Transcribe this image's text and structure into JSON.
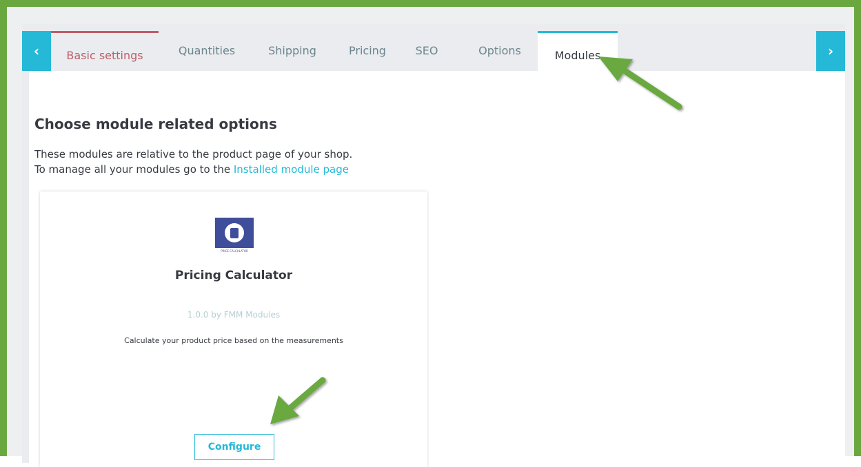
{
  "nav": {
    "prev_icon": "‹",
    "next_icon": "›"
  },
  "tabs": [
    {
      "label": "Basic settings"
    },
    {
      "label": "Quantities"
    },
    {
      "label": "Shipping"
    },
    {
      "label": "Pricing"
    },
    {
      "label": "SEO"
    },
    {
      "label": "Options"
    },
    {
      "label": "Modules"
    }
  ],
  "main": {
    "heading": "Choose module related options",
    "desc_line1": "These modules are relative to the product page of your shop.",
    "desc_line2": "To manage all your modules go to the",
    "link_text": "Installed module page"
  },
  "module": {
    "logo_caption": "PRICE CALCULATOR",
    "title": "Pricing Calculator",
    "version": "1.0.0 by FMM Modules",
    "description": "Calculate your product price based on the measurements",
    "configure_label": "Configure"
  },
  "colors": {
    "accent": "#25b9d7",
    "active_red": "#c05c67",
    "frame_green": "#6aa83f",
    "arrow_green": "#6aa83f"
  }
}
